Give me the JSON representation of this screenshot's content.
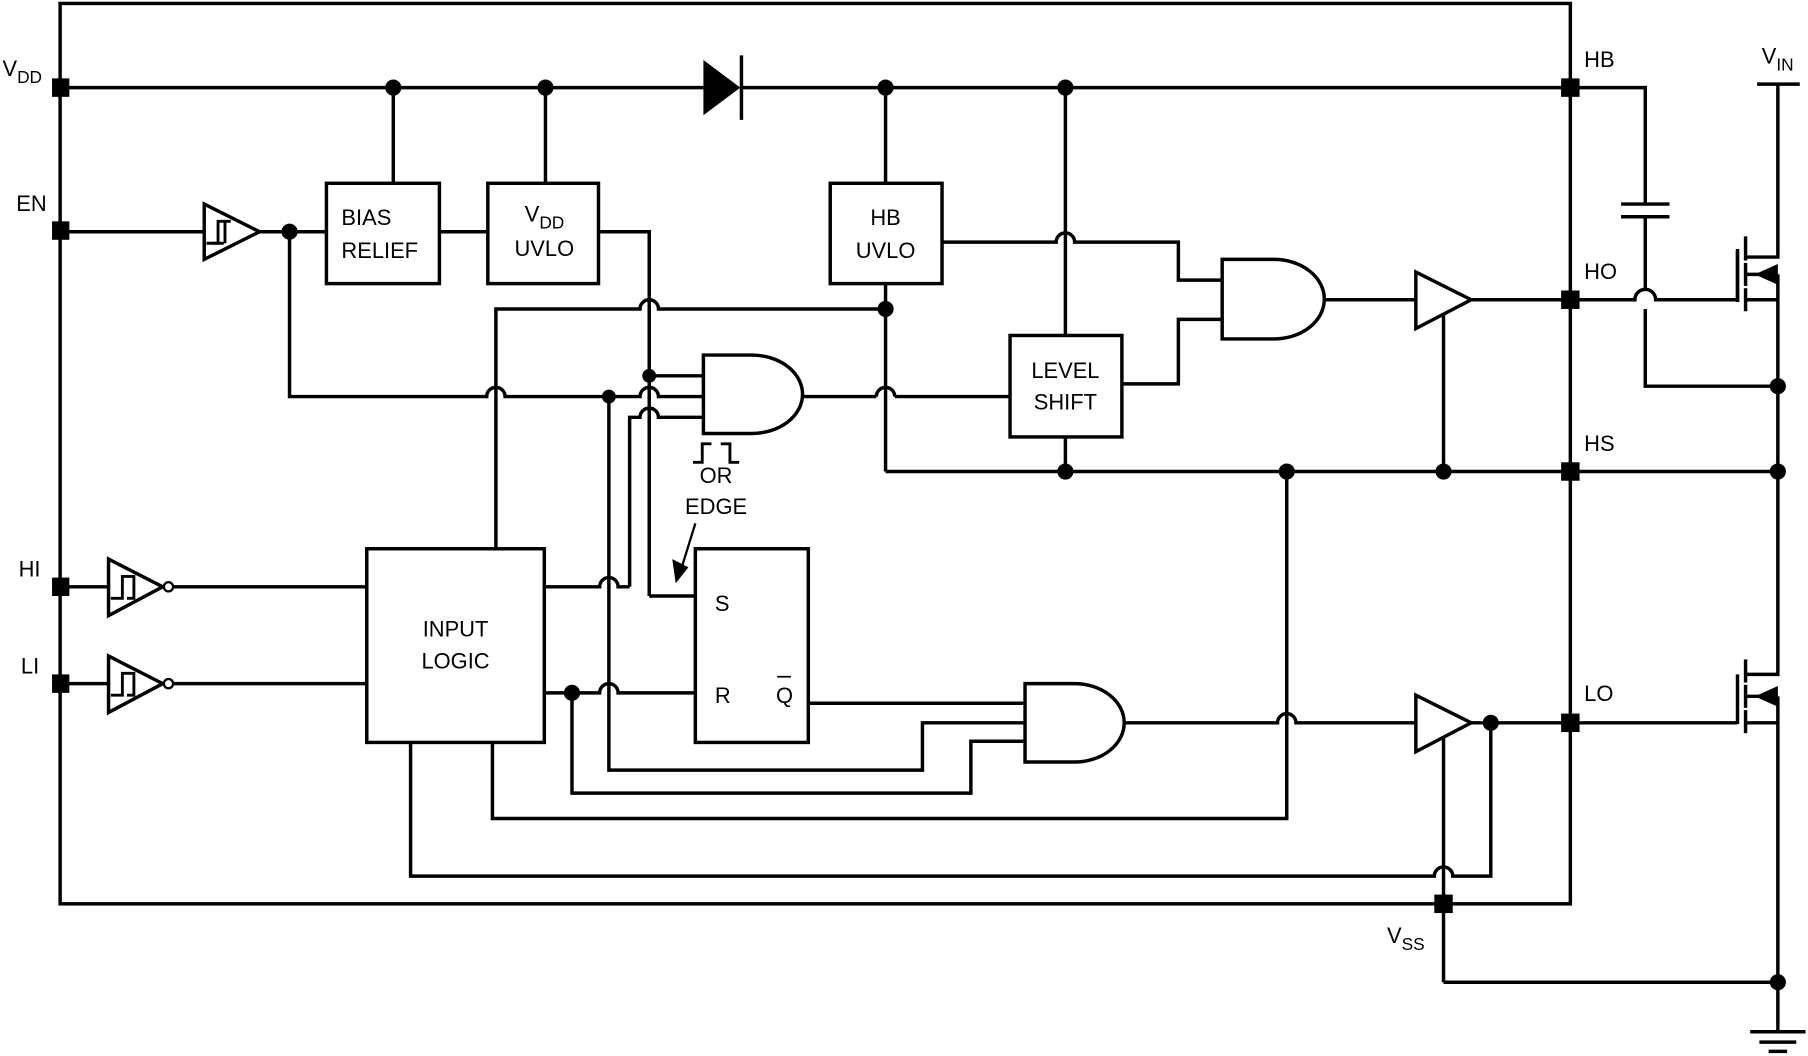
{
  "diagram": {
    "type": "functional-block-diagram",
    "pins": {
      "vdd": {
        "main": "V",
        "sub": "DD"
      },
      "en": "EN",
      "hi": "HI",
      "li": "LI",
      "hb": "HB",
      "ho": "HO",
      "hs": "HS",
      "lo": "LO",
      "vss": {
        "main": "V",
        "sub": "SS"
      },
      "vin": {
        "main": "V",
        "sub": "IN"
      }
    },
    "blocks": {
      "bias_relief": [
        "BIAS",
        "RELIEF"
      ],
      "vdd_uvlo": {
        "main": "V",
        "sub": "DD",
        "line2": "UVLO"
      },
      "hb_uvlo": [
        "HB",
        "UVLO"
      ],
      "level_shift": [
        "LEVEL",
        "SHIFT"
      ],
      "input_logic": [
        "INPUT",
        "LOGIC"
      ],
      "latch": {
        "set": "S",
        "reset": "R",
        "qbar": "Q"
      }
    },
    "annotations": {
      "pulse_label_1": "OR",
      "pulse_label_2": "EDGE"
    },
    "components": [
      "bootstrap-diode",
      "bootstrap-capacitor",
      "high-side-mosfet",
      "low-side-mosfet",
      "ground",
      "schmitt-buffer-en",
      "schmitt-inverter-hi",
      "schmitt-inverter-li",
      "and-gate-enable",
      "and-gate-high",
      "and-gate-low",
      "driver-high",
      "driver-low"
    ]
  }
}
